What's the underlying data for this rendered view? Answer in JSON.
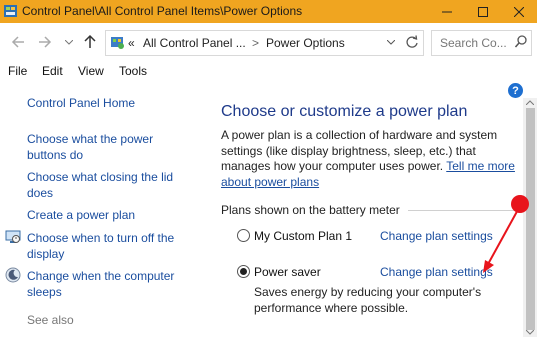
{
  "window": {
    "title": "Control Panel\\All Control Panel Items\\Power Options"
  },
  "nav": {
    "back_icon": "left-arrow",
    "forward_icon": "right-arrow",
    "recent_icon": "chevron-down",
    "up_icon": "up-arrow",
    "address": {
      "overflow": "«",
      "crumb1": "All Control Panel ...",
      "sep": ">",
      "crumb2": "Power Options"
    },
    "search_placeholder": "Search Co..."
  },
  "menu": [
    "File",
    "Edit",
    "View",
    "Tools"
  ],
  "sidebar": {
    "home": "Control Panel Home",
    "items": [
      {
        "label": "Choose what the power buttons do"
      },
      {
        "label": "Choose what closing the lid does"
      },
      {
        "label": "Create a power plan"
      },
      {
        "label": "Choose when to turn off the display"
      },
      {
        "label": "Change when the computer sleeps"
      }
    ],
    "see_also": "See also"
  },
  "main": {
    "title": "Choose or customize a power plan",
    "description": "A power plan is a collection of hardware and system settings (like display brightness, sleep, etc.) that manages how your computer uses power.",
    "learn_more": "Tell me more about power plans",
    "group_label": "Plans shown on the battery meter",
    "plans": [
      {
        "name": "My Custom Plan 1",
        "selected": false,
        "link": "Change plan settings"
      },
      {
        "name": "Power saver",
        "selected": true,
        "link": "Change plan settings",
        "description": "Saves energy by reducing your computer's performance where possible."
      }
    ]
  },
  "colors": {
    "titlebar": "#f0a520",
    "link": "#1a4d9e",
    "heading": "#1e3a8a",
    "annotation": "#e8141c"
  }
}
